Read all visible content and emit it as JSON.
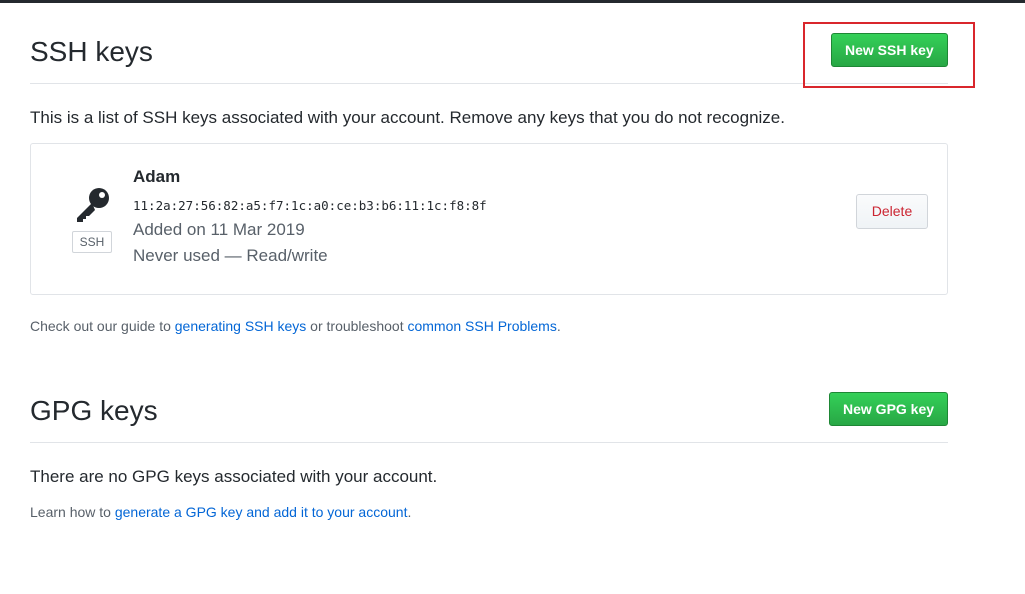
{
  "ssh": {
    "title": "SSH keys",
    "new_button": "New SSH key",
    "description": "This is a list of SSH keys associated with your account. Remove any keys that you do not recognize.",
    "keys": [
      {
        "name": "Adam",
        "fingerprint": "11:2a:27:56:82:a5:f7:1c:a0:ce:b3:b6:11:1c:f8:8f",
        "added": "Added on 11 Mar 2019",
        "usage": "Never used — Read/write",
        "badge": "SSH",
        "delete_label": "Delete",
        "icon": "key-icon"
      }
    ],
    "guide": {
      "prefix": "Check out our guide to ",
      "link1": "generating SSH keys",
      "middle": " or troubleshoot ",
      "link2": "common SSH Problems",
      "suffix": "."
    }
  },
  "gpg": {
    "title": "GPG keys",
    "new_button": "New GPG key",
    "empty_text": "There are no GPG keys associated with your account.",
    "learn": {
      "prefix": "Learn how to ",
      "link": "generate a GPG key and add it to your account",
      "suffix": "."
    }
  },
  "colors": {
    "primary_green": "#28a745",
    "link_blue": "#0366d6",
    "danger_red": "#cb2431",
    "highlight_red": "#d9262c"
  }
}
